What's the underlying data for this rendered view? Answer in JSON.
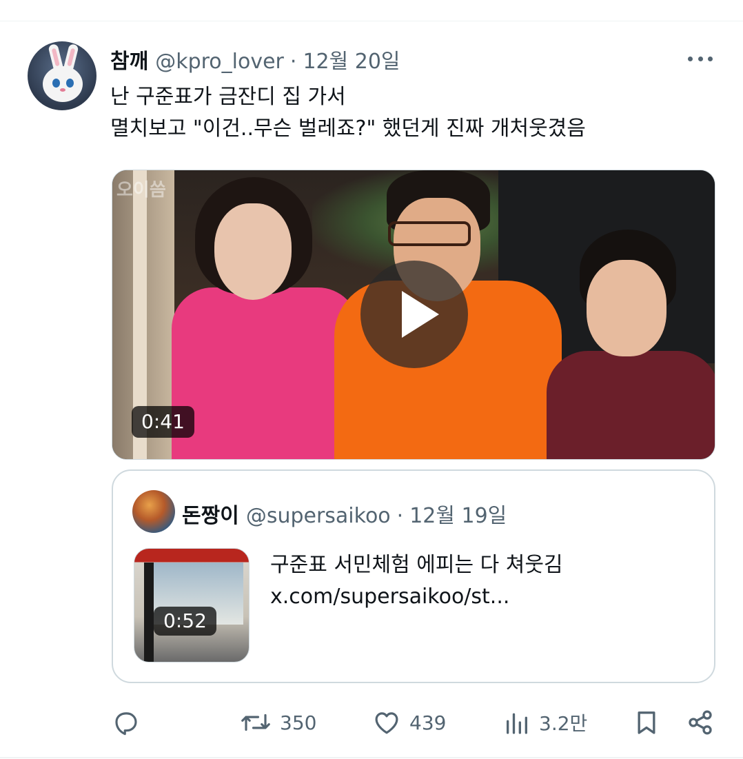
{
  "tweet": {
    "author": {
      "display_name": "참깨",
      "handle": "@kpro_lover",
      "separator": "·",
      "date": "12월 20일",
      "avatar_icon": "white-rabbit-avatar"
    },
    "text_lines": [
      "난 구준표가 금잔디 집 가서",
      "멸치보고 \"이건..무슨 벌레죠?\" 했던게 진짜 개처웃겼음"
    ],
    "media": {
      "type": "video",
      "duration": "0:41",
      "watermark": "오이씀"
    },
    "more_icon": "more-horizontal-icon"
  },
  "quoted_tweet": {
    "display_name": "돈짱이",
    "handle": "@supersaikoo",
    "separator": "·",
    "date": "12월 19일",
    "text_lines": [
      "구준표 서민체험 에피는 다 쳐웃김",
      "x.com/supersaikoo/st..."
    ],
    "thumbnail_duration": "0:52"
  },
  "actions": {
    "reply": {
      "icon": "reply-icon",
      "count": ""
    },
    "retweet": {
      "icon": "retweet-icon",
      "count": "350"
    },
    "like": {
      "icon": "heart-icon",
      "count": "439"
    },
    "views": {
      "icon": "views-chart-icon",
      "count": "3.2만"
    },
    "bookmark": {
      "icon": "bookmark-icon"
    },
    "share": {
      "icon": "share-icon"
    }
  },
  "colors": {
    "text_primary": "#0f1419",
    "text_secondary": "#536471",
    "border": "#cfd9de"
  }
}
